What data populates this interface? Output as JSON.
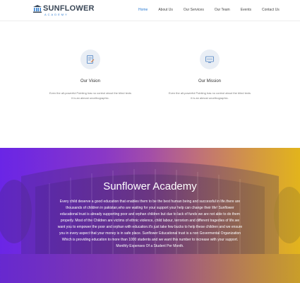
{
  "brand": {
    "title": "SUNFLOWER",
    "subtitle": "ACADEMY"
  },
  "nav": [
    {
      "label": "Home",
      "active": true
    },
    {
      "label": "About Us",
      "active": false
    },
    {
      "label": "Our Services",
      "active": false
    },
    {
      "label": "Our Team",
      "active": false
    },
    {
      "label": "Events",
      "active": false
    },
    {
      "label": "Contact Us",
      "active": false
    }
  ],
  "features": [
    {
      "icon": "document-icon",
      "title": "Our Vision",
      "text_line1": "Even the all-powerful Pointing has no control about the blind texts",
      "text_line2": "it is an almost unorthographic."
    },
    {
      "icon": "screen-icon",
      "title": "Our Mission",
      "text_line1": "Even the all-powerful Pointing has no control about the blind texts",
      "text_line2": "it is an almost unorthographic."
    }
  ],
  "hero": {
    "title": "Sunflower Academy",
    "text": "Every child deserve a good education that enables them to be the best human being and successful in life.there are thousands of children in pakistan,who are waiting for your support your help can change their life! Sunflower educational trust is already supporting poor and orphan children but due to lack of funds we are not able to do them properly. Most of the Children are victims of ethnic violence, child labour, terrorism and different tragedies of life.we want you to empower the poor and orphan with education.it's just take few bucks to help these children and we ensure you in every aspect that your money is in safe place. Sunflower Educational trust is a non Govermental Organization Which is providing education to more than 1000 students and we want this number to increase with your support. Monthly Expenses Of a Student Per Month."
  },
  "colors": {
    "accent": "#2b7bd3",
    "gradient_start": "#6a25e6",
    "gradient_end": "#e2b41c"
  }
}
